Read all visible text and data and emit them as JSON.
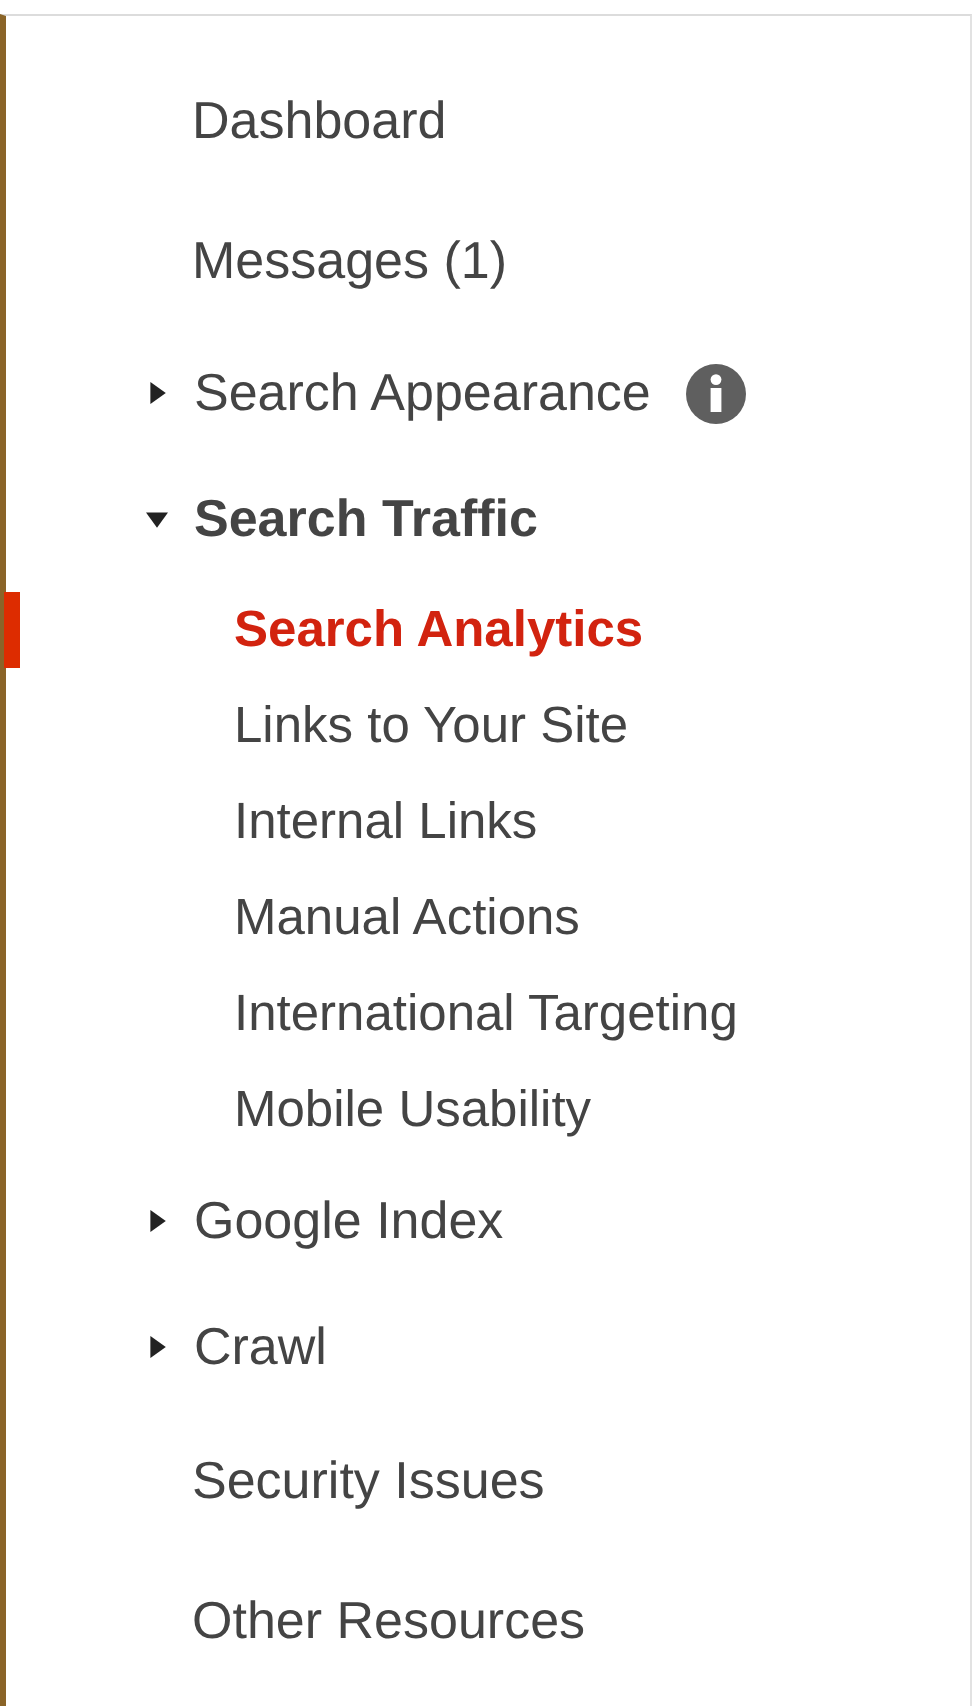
{
  "nav": [
    {
      "kind": "link",
      "label": "Dashboard"
    },
    {
      "kind": "link",
      "label": "Messages (1)"
    },
    {
      "kind": "section",
      "label": "Search Appearance",
      "expanded": false,
      "info": true
    },
    {
      "kind": "section",
      "label": "Search Traffic",
      "expanded": true,
      "children": [
        {
          "label": "Search Analytics",
          "selected": true
        },
        {
          "label": "Links to Your Site",
          "selected": false
        },
        {
          "label": "Internal Links",
          "selected": false
        },
        {
          "label": "Manual Actions",
          "selected": false
        },
        {
          "label": "International Targeting",
          "selected": false
        },
        {
          "label": "Mobile Usability",
          "selected": false
        }
      ]
    },
    {
      "kind": "section",
      "label": "Google Index",
      "expanded": false
    },
    {
      "kind": "section",
      "label": "Crawl",
      "expanded": false
    },
    {
      "kind": "link",
      "label": "Security Issues"
    },
    {
      "kind": "link",
      "label": "Other Resources"
    }
  ]
}
